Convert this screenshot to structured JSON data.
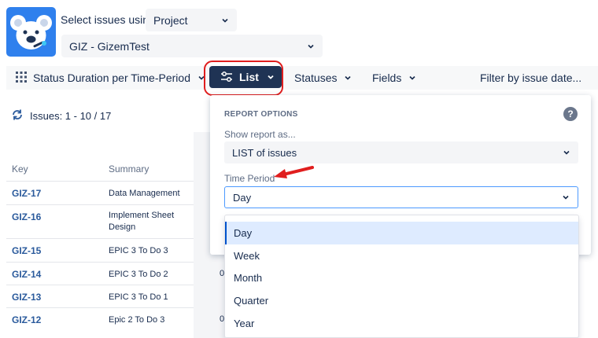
{
  "header": {
    "select_label": "Select issues using",
    "source_select": "Project",
    "project_select": "GIZ - GizemTest"
  },
  "toolbar": {
    "report_type": "Status Duration per Time-Period",
    "view_button": "List",
    "statuses": "Statuses",
    "fields": "Fields",
    "filter": "Filter by issue date..."
  },
  "issues": {
    "count_label": "Issues: 1 - 10 / 17",
    "columns": {
      "key": "Key",
      "summary": "Summary"
    },
    "rows": [
      {
        "key": "GIZ-17",
        "summary": "Data Management",
        "extra": ""
      },
      {
        "key": "GIZ-16",
        "summary": "Implement Sheet Design",
        "extra": ""
      },
      {
        "key": "GIZ-15",
        "summary": "EPIC 3 To Do 3",
        "extra": ""
      },
      {
        "key": "GIZ-14",
        "summary": "EPIC 3 To Do 2",
        "extra": "0"
      },
      {
        "key": "GIZ-13",
        "summary": "EPIC 3 To Do 1",
        "extra": ""
      },
      {
        "key": "GIZ-12",
        "summary": "Epic 2 To Do 3",
        "extra": "0"
      }
    ]
  },
  "report_options": {
    "title": "REPORT OPTIONS",
    "help": "?",
    "show_as_label": "Show report as...",
    "show_as_value": "LIST of issues",
    "time_period_label": "Time Period",
    "time_period_value": "Day",
    "options": [
      "Day",
      "Week",
      "Month",
      "Quarter",
      "Year"
    ],
    "selected": "Day"
  },
  "colors": {
    "accent": "#1f3354",
    "link": "#2a5a9c",
    "highlight": "#e01e1e",
    "logo_bg": "#2f80ed",
    "selected_option": "#deebff"
  }
}
